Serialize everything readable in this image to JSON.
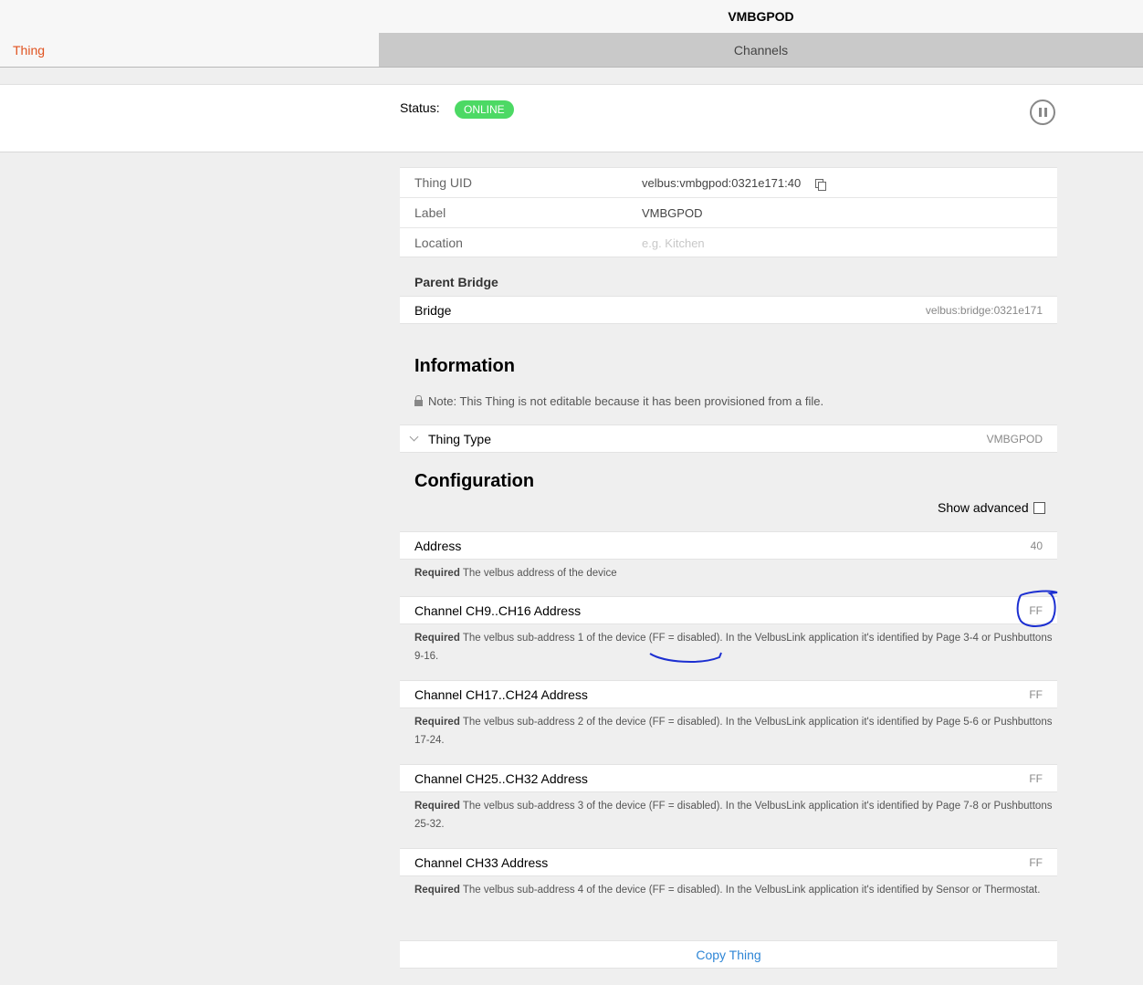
{
  "header": {
    "title": "VMBGPOD"
  },
  "tabs": {
    "thing": "Thing",
    "channels": "Channels"
  },
  "status": {
    "label": "Status:",
    "value": "ONLINE"
  },
  "properties": {
    "uid_label": "Thing UID",
    "uid_value": "velbus:vmbgpod:0321e171:40",
    "label_label": "Label",
    "label_value": "VMBGPOD",
    "location_label": "Location",
    "location_placeholder": "e.g. Kitchen"
  },
  "parent_bridge": {
    "title": "Parent Bridge",
    "label": "Bridge",
    "value": "velbus:bridge:0321e171"
  },
  "information": {
    "title": "Information",
    "note": "Note: This Thing is not editable because it has been provisioned from a file.",
    "thing_type_label": "Thing Type",
    "thing_type_value": "VMBGPOD"
  },
  "configuration": {
    "title": "Configuration",
    "show_advanced": "Show advanced",
    "required_label": "Required",
    "params": [
      {
        "label": "Address",
        "value": "40",
        "help": "The velbus address of the device"
      },
      {
        "label": "Channel CH9..CH16 Address",
        "value": "FF",
        "help": "The velbus sub-address 1 of the device (FF = disabled). In the VelbusLink application it's identified by Page 3-4 or Pushbuttons 9-16."
      },
      {
        "label": "Channel CH17..CH24 Address",
        "value": "FF",
        "help": "The velbus sub-address 2 of the device (FF = disabled). In the VelbusLink application it's identified by Page 5-6 or Pushbuttons 17-24."
      },
      {
        "label": "Channel CH25..CH32 Address",
        "value": "FF",
        "help": "The velbus sub-address 3 of the device (FF = disabled). In the VelbusLink application it's identified by Page 7-8 or Pushbuttons 25-32."
      },
      {
        "label": "Channel CH33 Address",
        "value": "FF",
        "help": "The velbus sub-address 4 of the device (FF = disabled). In the VelbusLink application it's identified by Sensor or Thermostat."
      }
    ]
  },
  "actions": {
    "copy_thing": "Copy Thing"
  },
  "colors": {
    "accent": "#e0521f",
    "online": "#4cd964",
    "link": "#2e86d6",
    "annotation": "#1c2fd1"
  }
}
